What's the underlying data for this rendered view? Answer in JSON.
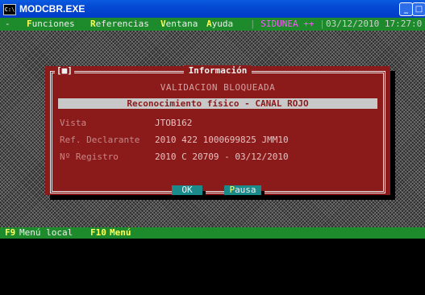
{
  "window": {
    "title": "MODCBR.EXE",
    "icon": "console-icon",
    "minimize": "_",
    "maximize": "□"
  },
  "menubar": {
    "dash": "-",
    "items": [
      {
        "hot": "F",
        "rest": "unciones"
      },
      {
        "hot": "R",
        "rest": "eferencias"
      },
      {
        "hot": "V",
        "rest": "entana"
      },
      {
        "hot": "A",
        "rest": "yuda"
      }
    ],
    "session": "| SIDUNEA ++ |",
    "datetime": "03/12/2010 17:27:0"
  },
  "dialog": {
    "close_box": "[■]",
    "title": "Información",
    "heading": "VALIDACION BLOQUEADA",
    "banner": "Reconocimiento físico - CANAL ROJO",
    "fields": [
      {
        "label": "Vista",
        "value": "JTOB162"
      },
      {
        "label": "Ref. Declarante",
        "value": "2010 422 1000699825 JMM10"
      },
      {
        "label": "Nº Registro",
        "value": "2010 C 20709 - 03/12/2010"
      }
    ],
    "buttons": {
      "ok": "OK",
      "pausa_hot": "P",
      "pausa_rest": "ausa"
    }
  },
  "statusbar": {
    "f9_key": "F9",
    "f9_label": "Menú local",
    "f10_key": "F10",
    "f10_label": "Menú"
  },
  "colors": {
    "dialog_bg": "#8b1a1a",
    "menubar_bg": "#1d8a2b",
    "button_bg": "#1a8a8a",
    "titlebar": "#0449d3"
  }
}
